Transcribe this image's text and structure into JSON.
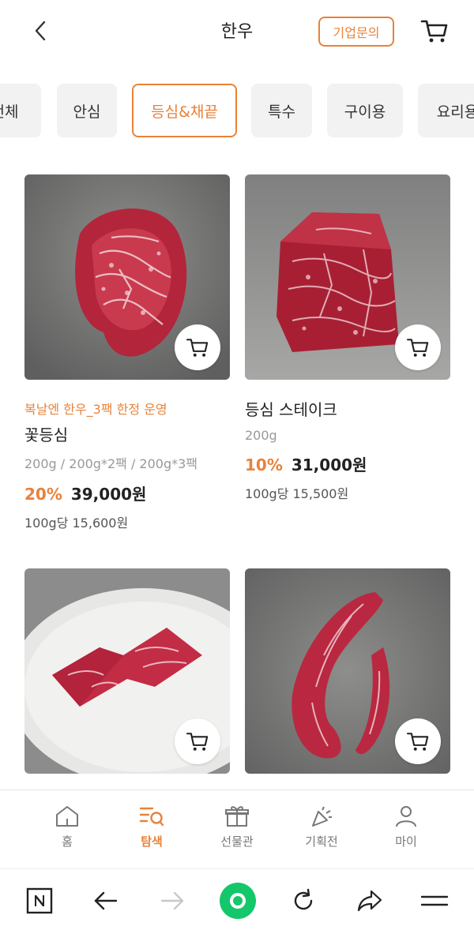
{
  "header": {
    "title": "한우",
    "inquiry_label": "기업문의"
  },
  "categories": [
    "전체",
    "안심",
    "등심&채끝",
    "특수",
    "구이용",
    "요리용"
  ],
  "active_category": "등심&채끝",
  "products": [
    {
      "promo": "복날엔 한우_3팩 한정 운영",
      "name": "꽃등심",
      "options": "200g / 200g*2팩 / 200g*3팩",
      "discount": "20%",
      "price": "39,000원",
      "unit_price": "100g당 15,600원"
    },
    {
      "promo": "",
      "name": "등심 스테이크",
      "options": "200g",
      "discount": "10%",
      "price": "31,000원",
      "unit_price": "100g당 15,500원"
    }
  ],
  "tabbar": [
    {
      "label": "홈",
      "icon": "home-icon"
    },
    {
      "label": "탐색",
      "icon": "search-list-icon",
      "active": true
    },
    {
      "label": "선물관",
      "icon": "gift-icon"
    },
    {
      "label": "기획전",
      "icon": "party-icon"
    },
    {
      "label": "마이",
      "icon": "person-icon"
    }
  ],
  "colors": {
    "accent": "#e8823a",
    "browser_green": "#14c76a"
  }
}
